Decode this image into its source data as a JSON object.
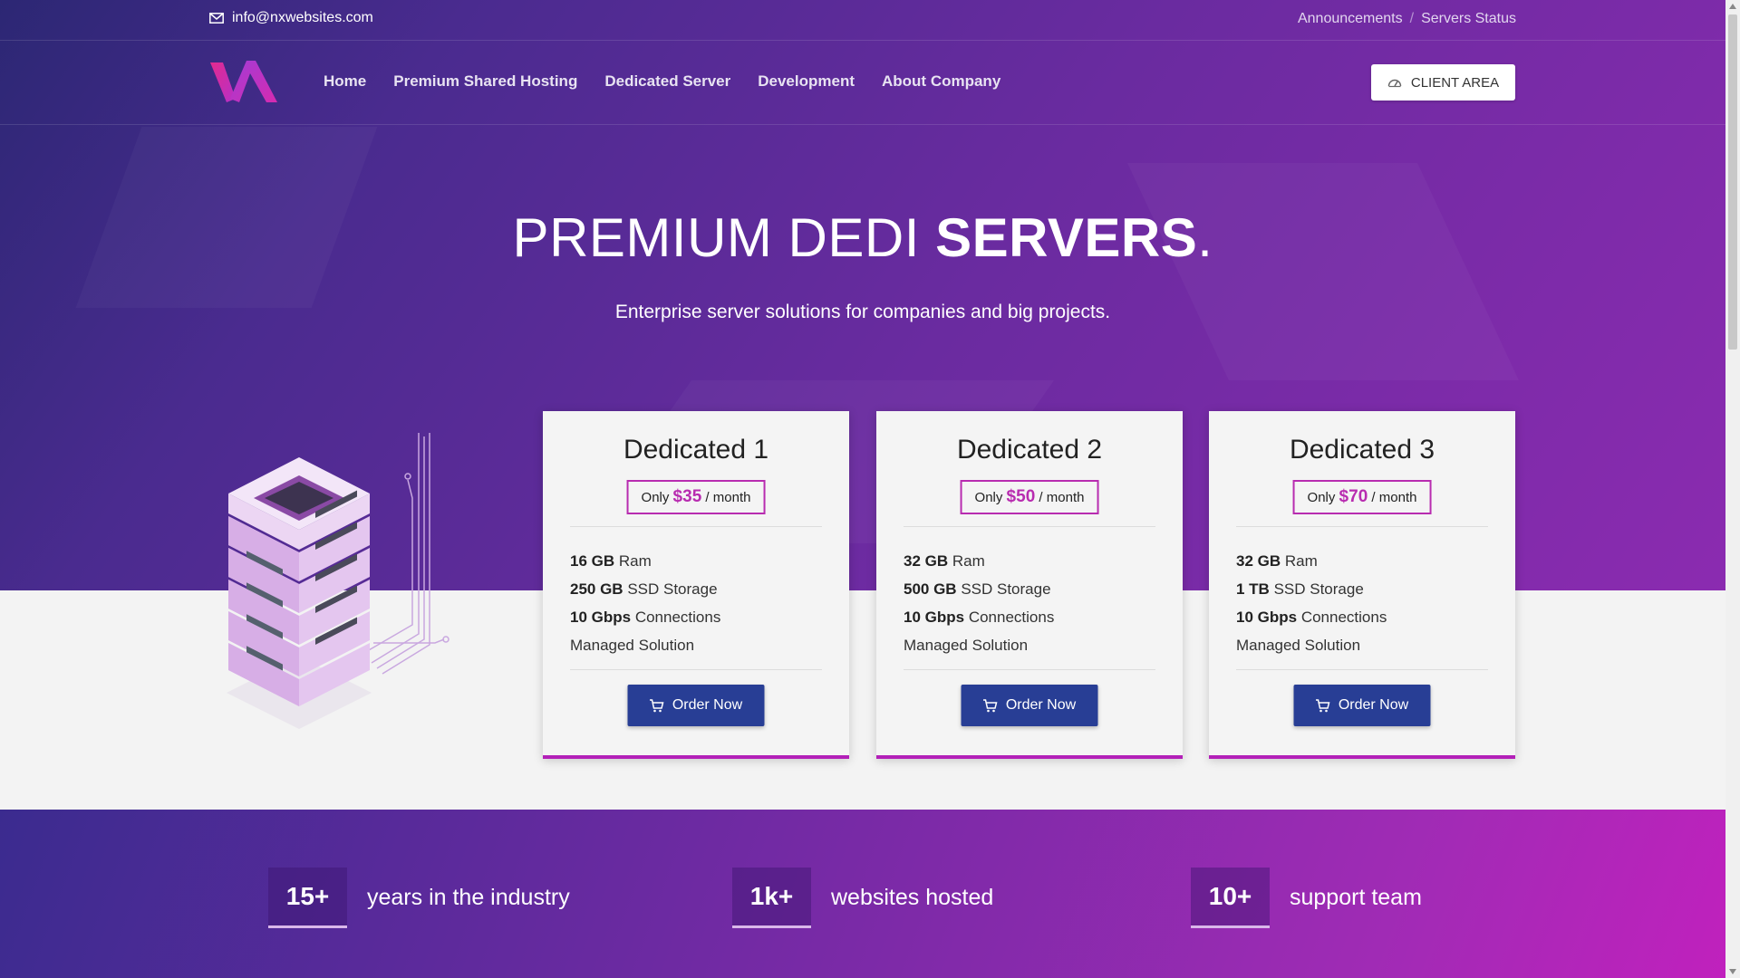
{
  "topbar": {
    "email": "info@nxwebsites.com",
    "links": [
      "Announcements",
      "Servers Status"
    ]
  },
  "nav": {
    "items": [
      "Home",
      "Premium Shared Hosting",
      "Dedicated Server",
      "Development",
      "About Company"
    ],
    "client_area": "CLIENT AREA"
  },
  "hero": {
    "title_light": "PREMIUM DEDI ",
    "title_bold": "SERVERS",
    "title_dot": ".",
    "subtitle": "Enterprise server solutions for companies and big projects."
  },
  "plans": [
    {
      "name": "Dedicated 1",
      "price_prefix": "Only ",
      "price": "$35",
      "price_suffix": " / month",
      "ram_value": "16 GB",
      "ram_label": " Ram",
      "storage_value": "250 GB",
      "storage_label": " SSD Storage",
      "net_value": "10 Gbps",
      "net_label": " Connections",
      "managed": "Managed Solution",
      "order": "Order Now"
    },
    {
      "name": "Dedicated 2",
      "price_prefix": "Only ",
      "price": "$50",
      "price_suffix": " / month",
      "ram_value": "32 GB",
      "ram_label": " Ram",
      "storage_value": "500 GB",
      "storage_label": " SSD Storage",
      "net_value": "10 Gbps",
      "net_label": " Connections",
      "managed": "Managed Solution",
      "order": "Order Now"
    },
    {
      "name": "Dedicated 3",
      "price_prefix": "Only ",
      "price": "$70",
      "price_suffix": " / month",
      "ram_value": "32 GB",
      "ram_label": " Ram",
      "storage_value": "1 TB",
      "storage_label": " SSD Storage",
      "net_value": "10 Gbps",
      "net_label": " Connections",
      "managed": "Managed Solution",
      "order": "Order Now"
    }
  ],
  "stats": [
    {
      "value": "15+",
      "label": "years in the industry"
    },
    {
      "value": "1k+",
      "label": "websites hosted"
    },
    {
      "value": "10+",
      "label": "support team"
    }
  ],
  "colors": {
    "accent": "#b82cb0",
    "button": "#283e95",
    "hero_start": "#2c2774",
    "hero_end": "#8b2bb0"
  },
  "icons": [
    "mail-icon",
    "dashboard-icon",
    "cart-icon",
    "logo-mark"
  ]
}
